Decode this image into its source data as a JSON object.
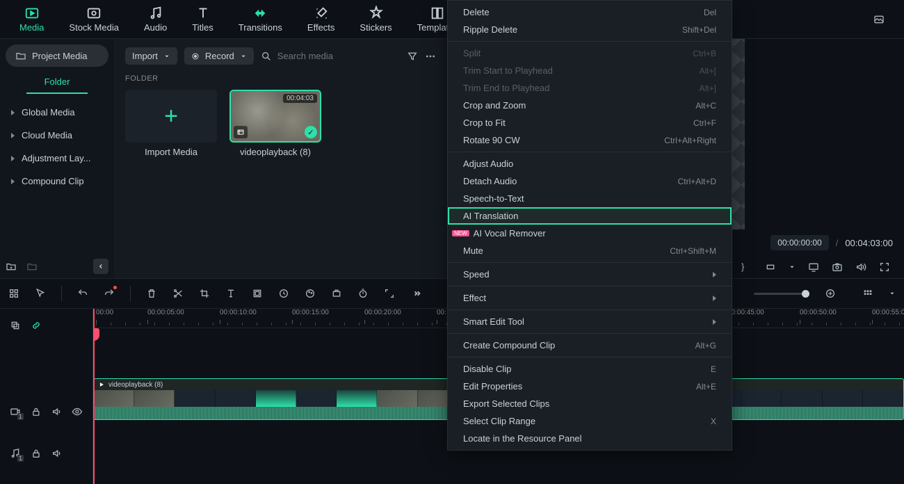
{
  "tabs": {
    "media": "Media",
    "stock": "Stock Media",
    "audio": "Audio",
    "titles": "Titles",
    "transitions": "Transitions",
    "effects": "Effects",
    "stickers": "Stickers",
    "templates": "Templates"
  },
  "sidebar": {
    "project_media": "Project Media",
    "folder_tab": "Folder",
    "items": [
      "Global Media",
      "Cloud Media",
      "Adjustment Lay...",
      "Compound Clip"
    ]
  },
  "media_toolbar": {
    "import": "Import",
    "record": "Record",
    "search_placeholder": "Search media"
  },
  "folder_section": {
    "label": "FOLDER",
    "import_tile": "Import Media",
    "clip_name": "videoplayback (8)",
    "clip_duration": "00:04:03"
  },
  "preview": {
    "current": "00:00:00:00",
    "total": "00:04:03:00"
  },
  "ruler_ticks": [
    "00:00",
    "00:00:05:00",
    "00:00:10:00",
    "00:00:15:00",
    "00:00:20:00",
    "00:00:45:00",
    "00:00:50:00",
    "00:00:55:0"
  ],
  "ruler_prefix_25": "00:",
  "track_clip_name": "videoplayback (8)",
  "video_track_badge": "1",
  "audio_track_badge": "1",
  "context_menu": {
    "groups": [
      [
        {
          "label": "Delete",
          "shortcut": "Del",
          "enabled": true
        },
        {
          "label": "Ripple Delete",
          "shortcut": "Shift+Del",
          "enabled": true
        }
      ],
      [
        {
          "label": "Split",
          "shortcut": "Ctrl+B",
          "enabled": false
        },
        {
          "label": "Trim Start to Playhead",
          "shortcut": "Alt+[",
          "enabled": false
        },
        {
          "label": "Trim End to Playhead",
          "shortcut": "Alt+]",
          "enabled": false
        },
        {
          "label": "Crop and Zoom",
          "shortcut": "Alt+C",
          "enabled": true
        },
        {
          "label": "Crop to Fit",
          "shortcut": "Ctrl+F",
          "enabled": true
        },
        {
          "label": "Rotate 90 CW",
          "shortcut": "Ctrl+Alt+Right",
          "enabled": true
        }
      ],
      [
        {
          "label": "Adjust Audio",
          "shortcut": "",
          "enabled": true
        },
        {
          "label": "Detach Audio",
          "shortcut": "Ctrl+Alt+D",
          "enabled": true
        },
        {
          "label": "Speech-to-Text",
          "shortcut": "",
          "enabled": true
        },
        {
          "label": "AI Translation",
          "shortcut": "",
          "enabled": true,
          "highlight": true
        },
        {
          "label": "AI Vocal Remover",
          "shortcut": "",
          "enabled": true,
          "badge": "NEW"
        },
        {
          "label": "Mute",
          "shortcut": "Ctrl+Shift+M",
          "enabled": true
        }
      ],
      [
        {
          "label": "Speed",
          "submenu": true,
          "enabled": true
        }
      ],
      [
        {
          "label": "Effect",
          "submenu": true,
          "enabled": true
        }
      ],
      [
        {
          "label": "Smart Edit Tool",
          "submenu": true,
          "enabled": true
        }
      ],
      [
        {
          "label": "Create Compound Clip",
          "shortcut": "Alt+G",
          "enabled": true
        }
      ],
      [
        {
          "label": "Disable Clip",
          "shortcut": "E",
          "enabled": true
        },
        {
          "label": "Edit Properties",
          "shortcut": "Alt+E",
          "enabled": true
        },
        {
          "label": "Export Selected Clips",
          "shortcut": "",
          "enabled": true
        },
        {
          "label": "Select Clip Range",
          "shortcut": "X",
          "enabled": true
        },
        {
          "label": "Locate in the Resource Panel",
          "shortcut": "",
          "enabled": true
        }
      ]
    ]
  }
}
